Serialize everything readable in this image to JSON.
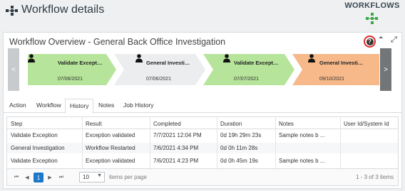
{
  "header": {
    "title": "Workflow details",
    "badge_label": "WORKFLOWS"
  },
  "panel": {
    "title": "Workflow Overview - General Back Office Investigation",
    "help_label": "?"
  },
  "stepper": {
    "prev_icon": "chevron-left-icon",
    "next_icon": "chevron-right-icon",
    "steps": [
      {
        "name": "Validate Exception",
        "date": "07/06/2021",
        "status_color": "#b6e49a"
      },
      {
        "name": "General Investigati...",
        "date": "07/06/2021",
        "status_color": "#ebedef"
      },
      {
        "name": "Validate Exception",
        "date": "07/07/2021",
        "status_color": "#b6e49a"
      },
      {
        "name": "General Investigati...",
        "date": "09/10/2021",
        "status_color": "#f7b98a"
      }
    ]
  },
  "tabs": [
    "Action",
    "Workflow",
    "History",
    "Notes",
    "Job History"
  ],
  "active_tab": "History",
  "history": {
    "columns": [
      "Step",
      "Result",
      "Completed",
      "Duration",
      "Notes",
      "User Id/System Id"
    ],
    "rows": [
      [
        "Validate Exception",
        "Exception validated",
        "7/7/2021 12:04 PM",
        "0d 19h 29m 23s",
        "Sample notes b ...",
        ""
      ],
      [
        "General Investigation",
        "Workflow Restarted",
        "7/6/2021 4:34 PM",
        "0d 0h 11m 28s",
        "",
        ""
      ],
      [
        "Validate Exception",
        "Exception validated",
        "7/6/2021 4:23 PM",
        "0d 0h 45m 19s",
        "Sample notes b ...",
        ""
      ]
    ]
  },
  "pager": {
    "first_icon": "first-page-icon",
    "prev_icon": "prev-page-icon",
    "current_page": "1",
    "next_icon": "next-page-icon",
    "last_icon": "last-page-icon",
    "page_size": "10",
    "page_size_label": "items per page",
    "info": "1 - 3 of 3 items"
  },
  "colors": {
    "accent": "#1e78c8",
    "complete": "#b6e49a",
    "current": "#f7b98a",
    "help_highlight": "#e02a2a",
    "brand_green": "#3aa845"
  }
}
